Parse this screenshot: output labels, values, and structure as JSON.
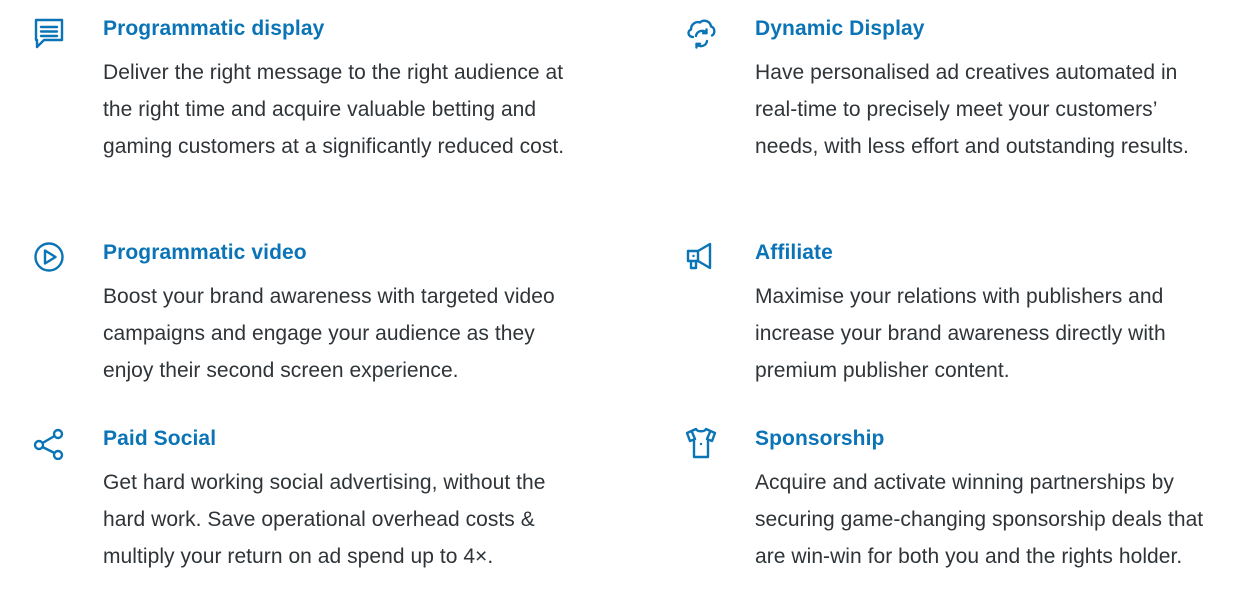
{
  "colors": {
    "heading": "#0b74b6",
    "body_text": "#2f3438",
    "icon": "#0b74b6"
  },
  "services": [
    {
      "icon": "chat-message-icon",
      "title": "Programmatic display",
      "description": "Deliver the right message to the right audience at the right time and acquire valuable betting and gaming customers at a significantly reduced cost."
    },
    {
      "icon": "cloud-sync-icon",
      "title": "Dynamic Display",
      "description": "Have personalised ad creatives automated in real-time to precisely meet your customers’ needs, with less effort and outstanding results."
    },
    {
      "icon": "play-circle-icon",
      "title": "Programmatic video",
      "description": "Boost your brand awareness with targeted video campaigns and engage your audience as they enjoy their second screen experience."
    },
    {
      "icon": "megaphone-icon",
      "title": "Affiliate",
      "description": "Maximise your relations with publishers and increase your brand awareness directly with premium publisher content."
    },
    {
      "icon": "share-icon",
      "title": "Paid Social",
      "description": "Get hard working social advertising, without the hard work. Save operational overhead costs & multiply your return on ad spend up to 4×."
    },
    {
      "icon": "jersey-icon",
      "title": "Sponsorship",
      "description": "Acquire and activate winning partnerships by securing game-changing sponsorship deals that are win-win for both you and the rights holder."
    }
  ]
}
